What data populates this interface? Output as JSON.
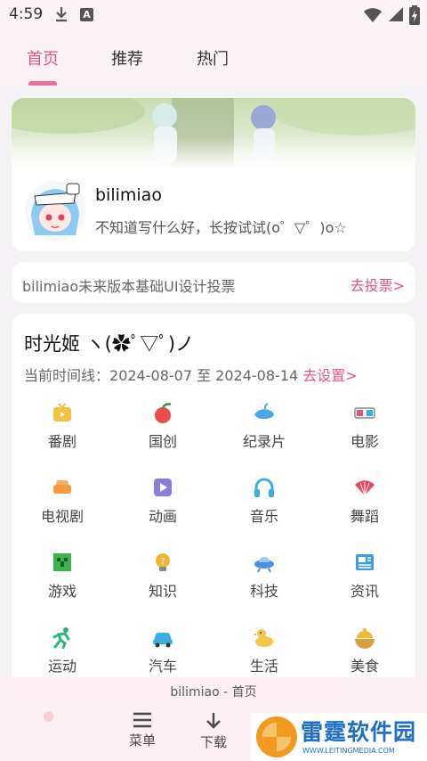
{
  "status": {
    "time": "4:59",
    "notif_letter": "A"
  },
  "tabs": [
    {
      "label": "首页"
    },
    {
      "label": "推荐"
    },
    {
      "label": "热门"
    }
  ],
  "profile": {
    "name": "bilimiao",
    "bio": "不知道写什么好，长按试试(o゜▽゜)o☆"
  },
  "notice": {
    "text": "bilimiao未来版本基础UI设计投票",
    "link": "去投票>"
  },
  "time_section": {
    "title": "时光姬 ヽ(✿ﾟ▽ﾟ)ノ",
    "range_label": "当前时间线：",
    "range": "2024-08-07 至 2024-08-14",
    "set_link": "去设置>"
  },
  "categories": [
    {
      "label": "番剧",
      "icon": "tv-icon",
      "color": "#f3c241"
    },
    {
      "label": "国创",
      "icon": "fruit-icon",
      "color": "#e84c4c"
    },
    {
      "label": "纪录片",
      "icon": "whale-icon",
      "color": "#4aa7e0"
    },
    {
      "label": "电影",
      "icon": "3d-glasses-icon",
      "color": "#e05576"
    },
    {
      "label": "电视剧",
      "icon": "sofa-icon",
      "color": "#f29a3c"
    },
    {
      "label": "动画",
      "icon": "play-icon",
      "color": "#8a7be0"
    },
    {
      "label": "音乐",
      "icon": "headphones-icon",
      "color": "#3aaedf"
    },
    {
      "label": "舞蹈",
      "icon": "fan-icon",
      "color": "#e8475d"
    },
    {
      "label": "游戏",
      "icon": "creeper-icon",
      "color": "#3cb44c"
    },
    {
      "label": "知识",
      "icon": "lightbulb-icon",
      "color": "#f2b532"
    },
    {
      "label": "科技",
      "icon": "ufo-icon",
      "color": "#4a8fe0"
    },
    {
      "label": "资讯",
      "icon": "newspaper-icon",
      "color": "#3c9ee0"
    },
    {
      "label": "运动",
      "icon": "runner-icon",
      "color": "#2fb57a"
    },
    {
      "label": "汽车",
      "icon": "car-icon",
      "color": "#3aaedf"
    },
    {
      "label": "生活",
      "icon": "duck-icon",
      "color": "#f4c64a"
    },
    {
      "label": "美食",
      "icon": "dish-icon",
      "color": "#f0b73a"
    }
  ],
  "bottom": {
    "title": "bilimiao - 首页",
    "menu_label": "菜单",
    "download_label": "下载"
  },
  "watermark": {
    "title": "雷霆软件园",
    "url": "WWW.LEITINGMEDIA.COM"
  }
}
